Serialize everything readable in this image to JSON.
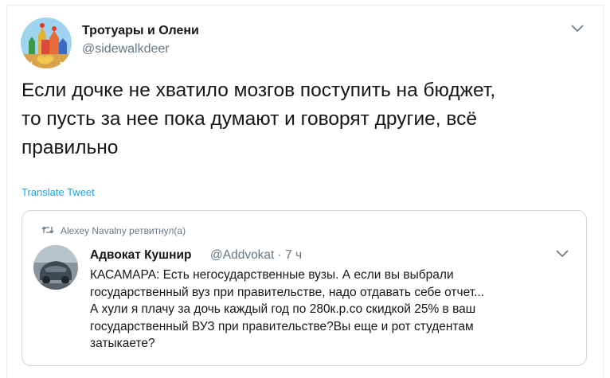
{
  "tweet": {
    "author_name": "Тротуары и Олени",
    "author_handle": "@sidewalkdeer",
    "text_lines": [
      "Если дочке не хватило мозгов поступить на бюджет,",
      "то пусть за нее пока думают и говорят другие, всё",
      "правильно"
    ],
    "translate_label": "Translate Tweet",
    "menu_icon": "chevron-down-icon",
    "avatar_icon": "kremlin-deer-avatar"
  },
  "quoted": {
    "retweet_note": "Alexey Navalny ретвитнул(а)",
    "retweet_icon": "retweet-icon",
    "author_name": "Адвокат Кушнир",
    "author_meta": "@Addvokat · 7 ч",
    "menu_icon": "chevron-down-icon",
    "text_lines": [
      "КАСАМАРА: Есть негосударственные вузы. А если вы выбрали",
      "государственный вуз при правительстве, надо отдавать себе отчет...",
      "А хули я плачу за дочь каждый год по 280к.р.со скидкой 25% в ваш",
      "государственный ВУЗ при правительстве?Вы еще и рот студентам",
      "затыкаете?"
    ]
  },
  "colors": {
    "text": "#14171a",
    "secondary": "#657786",
    "link": "#1da1f2",
    "border": "#ccd6dd"
  }
}
